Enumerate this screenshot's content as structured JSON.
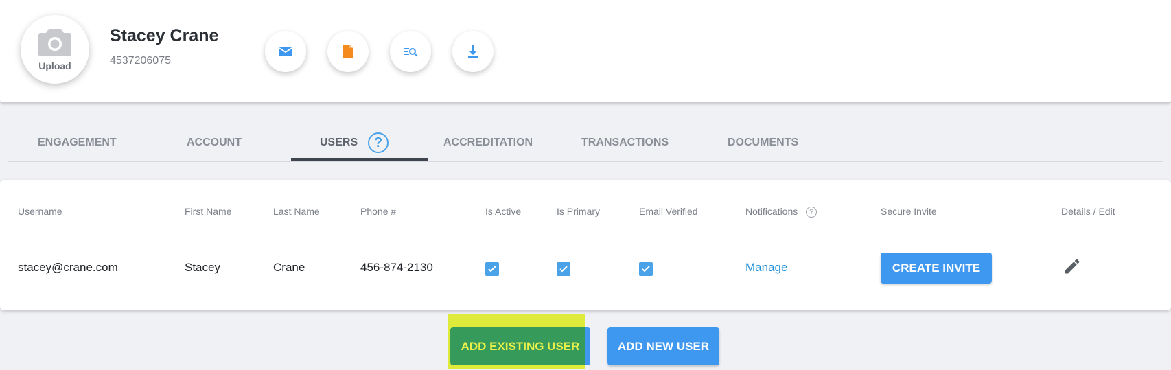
{
  "profile": {
    "upload_label": "Upload",
    "name": "Stacey Crane",
    "id": "4537206075"
  },
  "actions": [
    {
      "icon": "email-icon",
      "color": "#3f98f0"
    },
    {
      "icon": "document-icon",
      "color": "#f58a1f"
    },
    {
      "icon": "search-list-icon",
      "color": "#3f98f0"
    },
    {
      "icon": "download-icon",
      "color": "#3f98f0"
    }
  ],
  "tabs": {
    "engagement": "ENGAGEMENT",
    "account": "ACCOUNT",
    "users": "USERS",
    "accreditation": "ACCREDITATION",
    "transactions": "TRANSACTIONS",
    "documents": "DOCUMENTS",
    "help_symbol": "?",
    "active": "USERS"
  },
  "table": {
    "headers": {
      "username": "Username",
      "first_name": "First Name",
      "last_name": "Last Name",
      "phone": "Phone #",
      "is_active": "Is Active",
      "is_primary": "Is Primary",
      "email_verified": "Email Verified",
      "notifications": "Notifications",
      "notifications_help": "?",
      "secure_invite": "Secure Invite",
      "details_edit": "Details / Edit"
    },
    "rows": [
      {
        "username": "stacey@crane.com",
        "first_name": "Stacey",
        "last_name": "Crane",
        "phone": "456-874-2130",
        "is_active": true,
        "is_primary": true,
        "email_verified": true,
        "notifications_link": "Manage",
        "invite_button": "CREATE INVITE"
      }
    ]
  },
  "buttons": {
    "add_existing": "ADD EXISTING USER",
    "add_new": "ADD NEW USER"
  },
  "colors": {
    "accent_blue": "#3f98f0",
    "highlight": "#dfeb3a",
    "existing_green": "#359a5a"
  }
}
